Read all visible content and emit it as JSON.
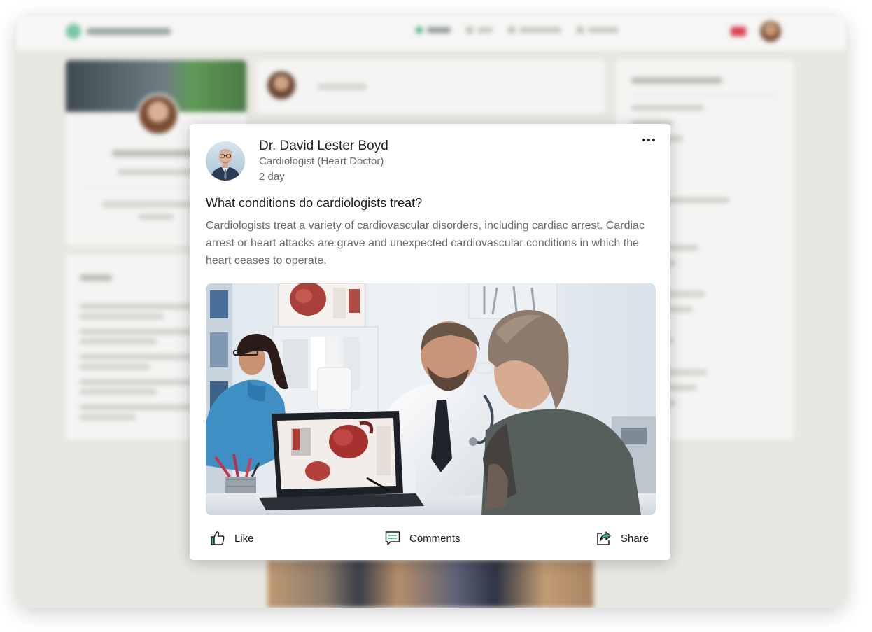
{
  "post": {
    "author_name": "Dr. David Lester Boyd",
    "author_role": "Cardiologist (Heart Doctor)",
    "time": "2 day",
    "title": "What conditions do cardiologists treat?",
    "body": "Cardiologists treat a variety of cardiovascular disorders, including cardiac arrest. Cardiac arrest or heart attacks are grave and unexpected cardiovascular conditions in which the heart ceases to operate.",
    "more_icon": "more-horizontal-icon",
    "actions": {
      "like_label": "Like",
      "like_icon": "thumbs-up-icon",
      "comments_label": "Comments",
      "comments_icon": "chat-bubble-icon",
      "share_label": "Share",
      "share_icon": "share-arrow-icon"
    }
  },
  "colors": {
    "accent_green": "#3fb27f",
    "card_background": "#ffffff",
    "body_text": "#6a6a6a"
  }
}
